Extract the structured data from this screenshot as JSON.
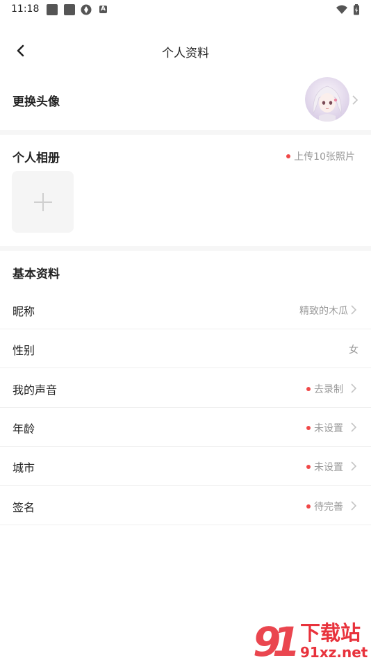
{
  "status_bar": {
    "time": "11:18"
  },
  "header": {
    "title": "个人资料"
  },
  "avatar_row": {
    "label": "更换头像"
  },
  "album": {
    "title": "个人相册",
    "hint": "上传10张照片"
  },
  "basic": {
    "title": "基本资料",
    "rows": [
      {
        "label": "昵称",
        "value": "精致的木瓜",
        "dot": false,
        "chevron": true
      },
      {
        "label": "性别",
        "value": "女",
        "dot": false,
        "chevron": false
      },
      {
        "label": "我的声音",
        "value": "去录制",
        "dot": true,
        "chevron": true
      },
      {
        "label": "年龄",
        "value": "未设置",
        "dot": true,
        "chevron": true
      },
      {
        "label": "城市",
        "value": "未设置",
        "dot": true,
        "chevron": true
      },
      {
        "label": "签名",
        "value": "待完善",
        "dot": true,
        "chevron": true
      }
    ]
  },
  "watermark": {
    "text_top": "下载站",
    "text_bottom": "91xz.net"
  },
  "colors": {
    "accent_dot": "#f04848",
    "watermark_red": "#e8323c"
  }
}
